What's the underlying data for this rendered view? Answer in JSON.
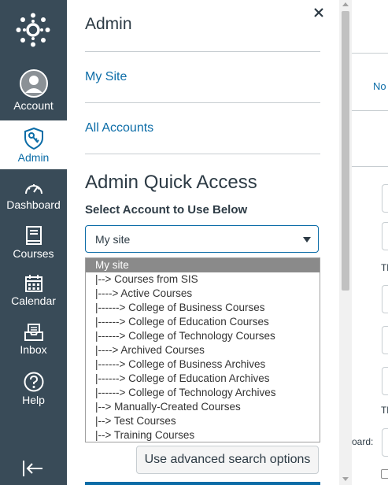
{
  "nav": {
    "items": [
      {
        "label": "Account",
        "icon": "account-avatar-icon"
      },
      {
        "label": "Admin",
        "icon": "shield-key-icon"
      },
      {
        "label": "Dashboard",
        "icon": "dashboard-gauge-icon"
      },
      {
        "label": "Courses",
        "icon": "book-icon"
      },
      {
        "label": "Calendar",
        "icon": "calendar-icon"
      },
      {
        "label": "Inbox",
        "icon": "inbox-icon"
      },
      {
        "label": "Help",
        "icon": "help-icon"
      }
    ],
    "colors": {
      "background": "#394b58",
      "active_text": "#0b6ca7"
    }
  },
  "tray": {
    "title": "Admin",
    "links": [
      "My Site",
      "All Accounts"
    ],
    "quick_access_title": "Admin Quick Access",
    "select_label": "Select Account to Use Below",
    "selected_value": "My site",
    "options": [
      "My site",
      "|--> Courses from SIS",
      "|----> Active Courses",
      "|------> College of Business Courses",
      "|------> College of Education Courses",
      "|------> College of Technology Courses",
      "|----> Archived Courses",
      "|------> College of Business Archives",
      "|------> College of Education Archives",
      "|------> College of Technology Archives",
      "|--> Manually-Created Courses",
      "|--> Test Courses",
      "|--> Training Courses"
    ],
    "advanced_button": "Use advanced search options"
  },
  "background": {
    "tab_partial": "No",
    "text_th_1": "Tl",
    "text_th_2": "Tl",
    "board_label": "oard:"
  }
}
